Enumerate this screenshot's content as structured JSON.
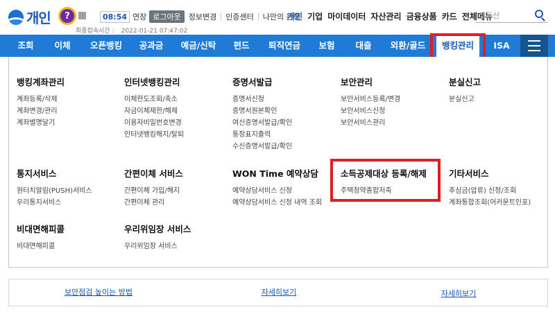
{
  "brand": {
    "logo_text": "개인",
    "help_glyph": "?"
  },
  "session": {
    "timer": "08:54",
    "extend_label": "연장",
    "logout_label": "로그아웃",
    "links": [
      "정보변경",
      "인증센터",
      "나만의 은행"
    ],
    "last_login_label": "최종접속시간 :",
    "last_login_value": "2022-01-21 07:47:02"
  },
  "top_menu": [
    "개인",
    "기업",
    "마이데이터",
    "자산관리",
    "금융상품",
    "카드",
    "전체메뉴"
  ],
  "search": {
    "placeholder": "부동산",
    "icon": "search-icon"
  },
  "nav": {
    "items": [
      "조회",
      "이체",
      "오픈뱅킹",
      "공과금",
      "예금/신탁",
      "펀드",
      "퇴직연금",
      "보험",
      "대출",
      "외환/골드",
      "뱅킹관리",
      "ISA"
    ],
    "current": "뱅킹관리",
    "menu_icon": "hamburger-icon"
  },
  "menu": {
    "sections": [
      {
        "title": "뱅킹계좌관리",
        "items": [
          "계좌등록/삭제",
          "계좌변경/관리",
          "계좌별명달기"
        ]
      },
      {
        "title": "인터넷뱅킹관리",
        "items": [
          "이체한도조회/축소",
          "자금이체제한/해제",
          "이용자비밀번호변경",
          "인터넷뱅킹해지/탈퇴"
        ]
      },
      {
        "title": "증명서발급",
        "items": [
          "증명서신청",
          "증명서원본확인",
          "여신증명서발급/확인",
          "통장표지출력",
          "수신증명서발급/확인"
        ]
      },
      {
        "title": "보안관리",
        "items": [
          "보안서비스등록/변경",
          "보안서비스신청",
          "보안서비스관리"
        ]
      },
      {
        "title": "분실신고",
        "items": [
          "분실신고"
        ]
      },
      {
        "title": "통지서비스",
        "items": [
          "원터치알림(PUSH)서비스",
          "우리통지서비스"
        ]
      },
      {
        "title": "간편이체 서비스",
        "items": [
          "간편이체 가입/해지",
          "간편이체 관리"
        ]
      },
      {
        "title": "WON Time 예약상담",
        "items": [
          "예약상담서비스 신청",
          "예약상담서비스 신청 내역 조회"
        ]
      },
      {
        "title": "소득공제대상 등록/해제",
        "items": [
          "주택청약종합저축"
        ]
      },
      {
        "title": "기타서비스",
        "items": [
          "추심금(압류) 신청/조회",
          "계좌통합조회(어카운트인포)"
        ]
      },
      {
        "title": "비대면해피콜",
        "items": [
          "비대면해피콜"
        ]
      },
      {
        "title": "우리위임장 서비스",
        "items": [
          "우리위임장 서비스"
        ]
      }
    ]
  },
  "bottom_links": [
    "보안점검 높이는 방법",
    "자세히보기",
    "자세히보기"
  ],
  "colors": {
    "nav_bg": "#1f7bd6",
    "brand_blue": "#1b57b6",
    "highlight_red": "#e01e25",
    "help_yellow": "#f2b81c"
  }
}
